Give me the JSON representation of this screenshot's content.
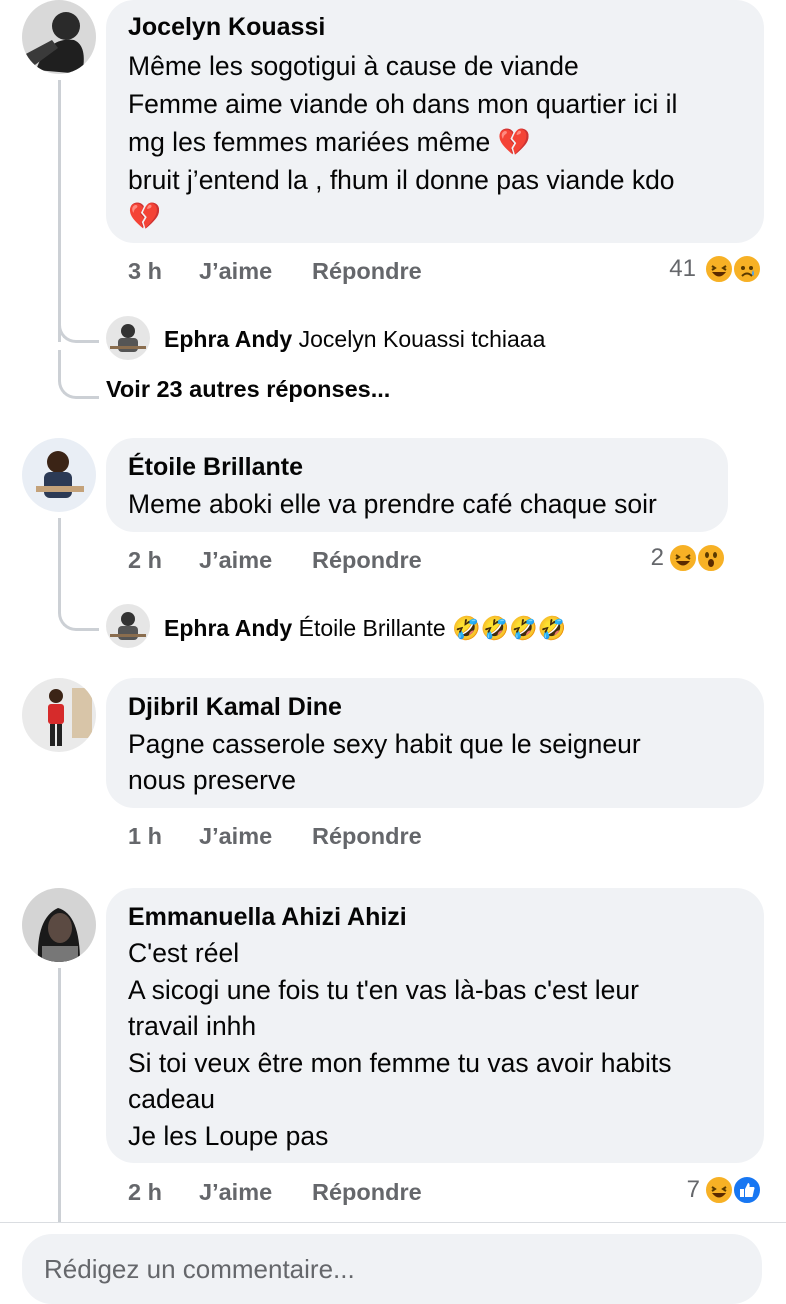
{
  "comments": [
    {
      "author": "Jocelyn Kouassi",
      "lines": [
        "Même les sogotigui à cause de viande",
        "Femme aime viande oh dans mon quartier ici il",
        "mg les femmes mariées même 💔",
        "bruit j’entend la , fhum il donne pas viande kdo",
        "💔"
      ],
      "time": "3 h",
      "like": "J’aime",
      "reply": "Répondre",
      "reaction_count": "41",
      "reactions": [
        "haha",
        "sad"
      ]
    },
    {
      "author": "Étoile Brillante",
      "lines": [
        "Meme aboki elle va prendre café chaque soir"
      ],
      "time": "2 h",
      "like": "J’aime",
      "reply": "Répondre",
      "reaction_count": "2",
      "reactions": [
        "haha",
        "wow"
      ]
    },
    {
      "author": "Djibril Kamal Dine",
      "lines": [
        "Pagne casserole sexy habit que le seigneur",
        "nous preserve"
      ],
      "time": "1 h",
      "like": "J’aime",
      "reply": "Répondre"
    },
    {
      "author": "Emmanuella Ahizi Ahizi",
      "lines": [
        "C'est réel",
        "A sicogi une fois tu t'en vas là-bas c'est leur",
        "travail inhh",
        "Si toi veux être mon femme tu vas avoir habits",
        "cadeau",
        "Je les Loupe pas"
      ],
      "time": "2 h",
      "like": "J’aime",
      "reply": "Répondre",
      "reaction_count": "7",
      "reactions": [
        "haha",
        "like"
      ]
    }
  ],
  "replies": [
    {
      "author": "Ephra Andy",
      "text": "Jocelyn Kouassi tchiaaa"
    },
    {
      "author": "Ephra Andy",
      "text": "Étoile Brillante 🤣🤣🤣🤣"
    }
  ],
  "more_replies": "Voir 23 autres réponses...",
  "composer": {
    "placeholder": "Rédigez un commentaire..."
  },
  "colors": {
    "bubble": "#f0f2f5",
    "meta_text": "#65676b",
    "haha_yellow": "#f7b125",
    "like_blue": "#1877f2",
    "heart_red": "#c3272b"
  }
}
